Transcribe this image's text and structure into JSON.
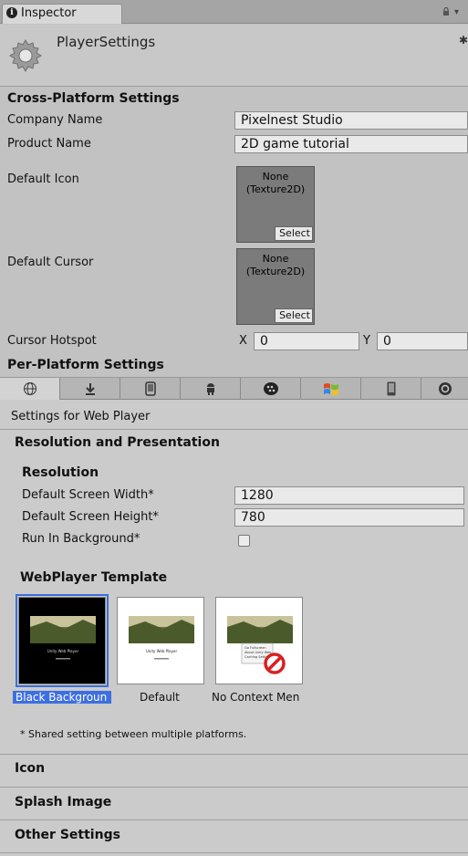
{
  "tab": {
    "title": "Inspector"
  },
  "header": {
    "title": "PlayerSettings"
  },
  "cross_platform": {
    "title": "Cross-Platform Settings",
    "company_name_label": "Company Name",
    "company_name_value": "Pixelnest Studio",
    "product_name_label": "Product Name",
    "product_name_value": "2D game tutorial",
    "default_icon_label": "Default Icon",
    "default_cursor_label": "Default Cursor",
    "texture_none": "None",
    "texture_type": "(Texture2D)",
    "select_label": "Select",
    "cursor_hotspot_label": "Cursor Hotspot",
    "hotspot_x_label": "X",
    "hotspot_x_value": "0",
    "hotspot_y_label": "Y",
    "hotspot_y_value": "0"
  },
  "per_platform": {
    "title": "Per-Platform Settings",
    "tabs": [
      "web-player",
      "standalone",
      "ios",
      "android",
      "blackberry",
      "windows-store",
      "windows-phone",
      "ouya"
    ],
    "selected_tab": "web-player",
    "settings_for": "Settings for Web Player"
  },
  "resolution": {
    "section_title": "Resolution and Presentation",
    "sub_title": "Resolution",
    "width_label": "Default Screen Width*",
    "width_value": "1280",
    "height_label": "Default Screen Height*",
    "height_value": "780",
    "run_bg_label": "Run In Background*",
    "run_bg_checked": false
  },
  "webplayer_template": {
    "title": "WebPlayer Template",
    "templates": [
      {
        "label": "Black Backgroun",
        "selected": true
      },
      {
        "label": "Default",
        "selected": false
      },
      {
        "label": "No Context Men",
        "selected": false
      }
    ],
    "thumb_text": "Unity Web Player",
    "menu_lines": [
      "Go Fullscreen",
      "About Unity Web...",
      "Caching Settings"
    ]
  },
  "shared_note": "* Shared setting between multiple platforms.",
  "collapsed_sections": [
    "Icon",
    "Splash Image",
    "Other Settings"
  ]
}
